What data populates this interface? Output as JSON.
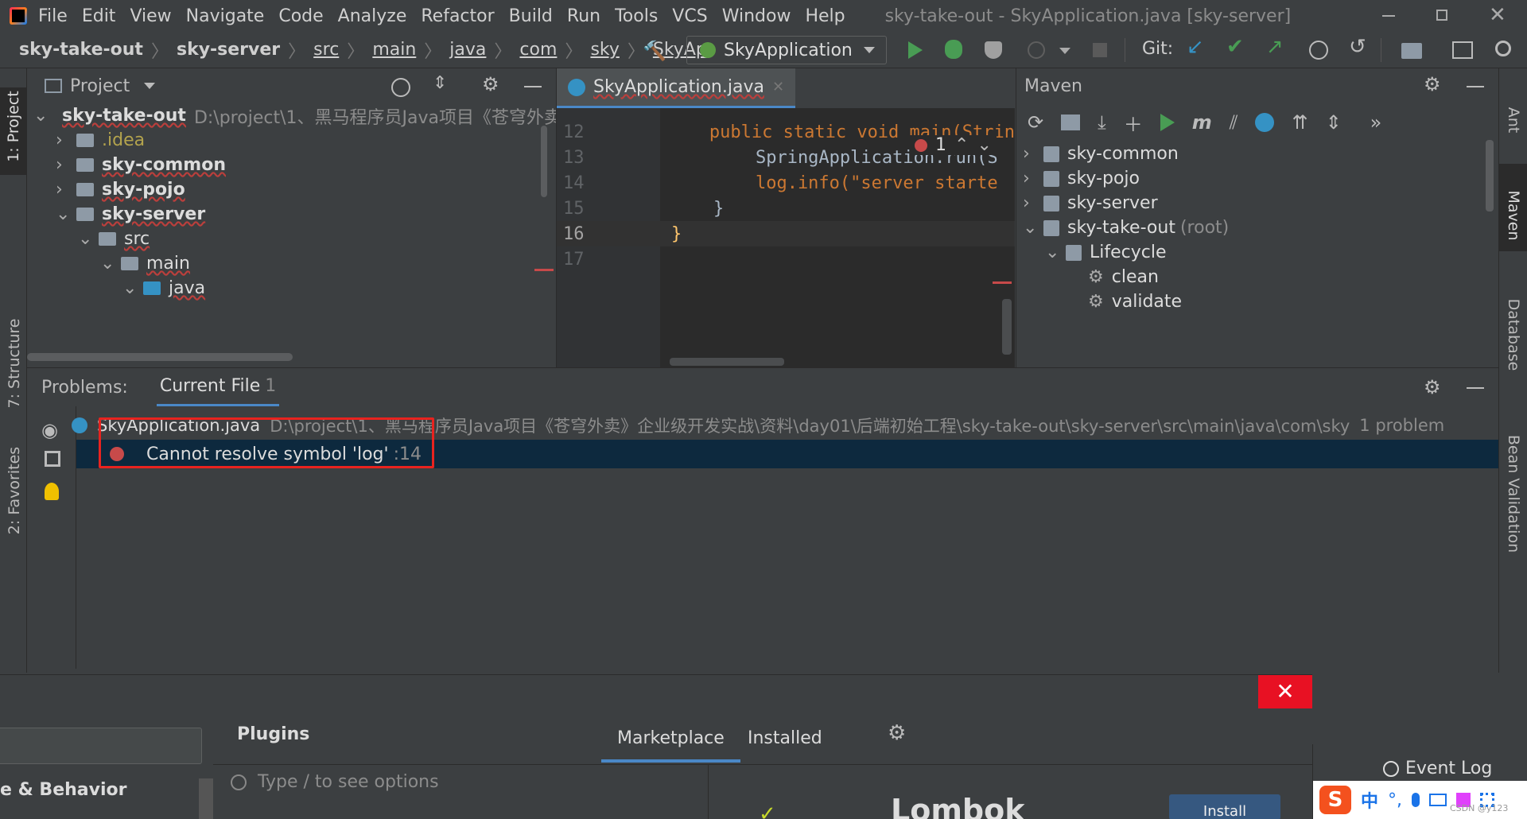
{
  "app": {
    "title": "sky-take-out - SkyApplication.java [sky-server]",
    "menu": [
      "File",
      "Edit",
      "View",
      "Navigate",
      "Code",
      "Analyze",
      "Refactor",
      "Build",
      "Run",
      "Tools",
      "VCS",
      "Window",
      "Help"
    ]
  },
  "breadcrumbs": [
    "sky-take-out",
    "sky-server",
    "src",
    "main",
    "java",
    "com",
    "sky",
    "SkyAp"
  ],
  "toolbar": {
    "run_config": "SkyApplication",
    "git_label": "Git:"
  },
  "left_tabs": {
    "project": "1: Project",
    "structure": "7: Structure",
    "favorites": "2: Favorites"
  },
  "right_tabs": {
    "ant": "Ant",
    "maven": "Maven",
    "database": "Database",
    "bean": "Bean Validation"
  },
  "project_panel": {
    "title": "Project",
    "tree": [
      {
        "label": "sky-take-out",
        "path": "D:\\project\\1、黑马程序员Java项目《苍穹外卖",
        "depth": 0,
        "expanded": true,
        "bold": true
      },
      {
        "label": ".idea",
        "depth": 1,
        "expanded": false
      },
      {
        "label": "sky-common",
        "depth": 1,
        "expanded": false,
        "bold": true
      },
      {
        "label": "sky-pojo",
        "depth": 1,
        "expanded": false,
        "bold": true
      },
      {
        "label": "sky-server",
        "depth": 1,
        "expanded": true,
        "bold": true
      },
      {
        "label": "src",
        "depth": 2,
        "expanded": true
      },
      {
        "label": "main",
        "depth": 3,
        "expanded": true
      },
      {
        "label": "java",
        "depth": 4,
        "expanded": true
      }
    ]
  },
  "editor": {
    "tab": "SkyApplication.java",
    "error_count": "1",
    "lines": [
      {
        "num": "12",
        "code": "    public static void main(Strin"
      },
      {
        "num": "13",
        "code": "        SpringApplication.run(S"
      },
      {
        "num": "14",
        "code": "        log.info(\"server starte"
      },
      {
        "num": "15",
        "code": "    }"
      },
      {
        "num": "16",
        "code": "}"
      },
      {
        "num": "17",
        "code": ""
      }
    ]
  },
  "maven": {
    "title": "Maven",
    "tree": [
      {
        "label": "sky-common",
        "depth": 0
      },
      {
        "label": "sky-pojo",
        "depth": 0
      },
      {
        "label": "sky-server",
        "depth": 0
      },
      {
        "label": "sky-take-out",
        "suffix": "(root)",
        "depth": 0,
        "expanded": true
      },
      {
        "label": "Lifecycle",
        "depth": 1,
        "expanded": true
      },
      {
        "label": "clean",
        "depth": 2
      },
      {
        "label": "validate",
        "depth": 2
      }
    ]
  },
  "problems": {
    "title": "Problems:",
    "tab": "Current File",
    "tab_count": "1",
    "file": "SkyApplication.java",
    "file_path": "D:\\project\\1、黑马程序员Java项目《苍穹外卖》企业级开发实战\\资料\\day01\\后端初始工程\\sky-take-out\\sky-server\\src\\main\\java\\com\\sky",
    "file_count": "1 problem",
    "error_text": "Cannot resolve symbol 'log'",
    "error_line": ":14"
  },
  "plugins": {
    "left_item": "e & Behavior",
    "title": "Plugins",
    "tabs": [
      "Marketplace",
      "Installed"
    ],
    "search_placeholder": "Type / to see options",
    "plugin_name": "Lombok",
    "install_label": "Install"
  },
  "status": {
    "event_log": "Event Log",
    "ime": "中",
    "watermark": "CSDN @y123"
  }
}
